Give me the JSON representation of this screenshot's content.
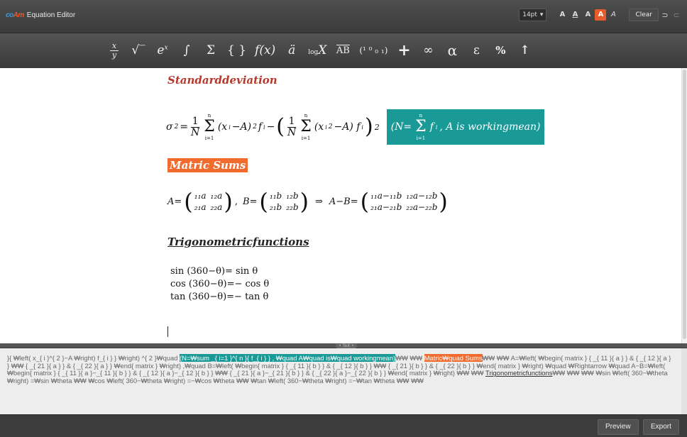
{
  "app": {
    "logo_a": "co",
    "logo_b": "Am",
    "title": "Equation Editor"
  },
  "header": {
    "font_size": "14pt",
    "font_size_arrow": "▾",
    "format_buttons": [
      "A",
      "A",
      "A",
      "A",
      "A"
    ],
    "clear_label": "Clear",
    "undo_glyph": "⊃",
    "redo_glyph": "⊂"
  },
  "toolbar": {
    "frac_num": "x",
    "frac_den": "y",
    "sqrt": "√‾",
    "exp_e": "e",
    "exp_x": "x",
    "integral": "∫",
    "sum": "Σ",
    "braces": "{ }",
    "function": "f(x)",
    "dots": "ä",
    "log": "log",
    "log_x": "X",
    "vector": "AB",
    "matrix": "(¹ ⁰ ₀ ₁)",
    "plus": "+",
    "infinity": "∞",
    "alpha": "α",
    "epsilon": "ε",
    "percent": "%",
    "arrow_up": "↑"
  },
  "document": {
    "heading1": "Standarddeviation",
    "heading2": "Matric  Sums",
    "heading3": "Trigonometricfunctions",
    "eq1": {
      "sigma": "σ",
      "sq": "2",
      "eq": "=",
      "one": "1",
      "N": "N",
      "sum_top": "n",
      "sum_bot": "i=1",
      "sum_sym": "Σ",
      "term1": "(x",
      "i": "i",
      "minus_A": "−A)",
      "pow2": "2",
      "f": "f",
      "minus": " − ",
      "term2": "(x",
      "minus_A2": "−A) f",
      "teal": "(N=",
      "teal_f": "f",
      "teal_rest": ", A  is  workingmean)"
    },
    "eq2": {
      "A": "A=",
      "B": "B=",
      "sep": ",",
      "arrow": "⇒",
      "AB": "A−B=",
      "a11": "₁₁a",
      "a12": "₁₂a",
      "a21": "₂₁a",
      "a22": "₂₂a",
      "b11": "₁₁b",
      "b12": "₁₂b",
      "b21": "₂₁b",
      "b22": "₂₂b",
      "c11": "₁₁a−₁₁b",
      "c12": "₁₂a−₁₂b",
      "c21": "₂₁a−₂₁b",
      "c22": "₂₂a−₂₂b"
    },
    "trig": [
      "sin (360−θ)= sin θ",
      "cos (360−θ)=− cos θ",
      "tan (360−θ)=− tan θ"
    ]
  },
  "splitter_label": "• TeX •",
  "source": {
    "part1": "}{ ₩left( x_{ i }^{ 2 }−A ₩right) f_{ i } }  ₩right) ^{ 2 }₩quad ",
    "teal": "(N=₩sum _{ i=1 }^{ n }{ f_{ i } } , ₩quad A₩quad is₩quad workingmean)",
    "part2": "₩₩ ₩₩ ",
    "orange": "Matric₩quad Sums",
    "part3": "₩₩ ₩₩ A=₩left( ₩begin{ matrix } { _{ 11 }{ a } } & { _{ 12 }{ a } } ₩₩ { _{ 21 }{ a } } & { _{ 22 }{ a } } ₩end{ matrix } ₩right) ,₩quad B=₩left( ₩begin{ matrix } { _{ 11 }{ b } } & { _{ 12 }{ b } } ₩₩ { _{ 21 }{ b } } & { _{ 22 }{ b } } ₩end{ matrix } ₩right) ₩quad ₩Rightarrow ₩quad A−B=₩left( ₩begin{ matrix } { _{ 11 }{ a }−_{ 11 }{ b } } & { _{ 12 }{ a }−_{ 12 }{ b } } ₩₩ { _{ 21 }{ a }−_{ 21 }{ b } } & { _{ 22 }{ a }−_{ 22 }{ b } } ₩end{ matrix } ₩right) ₩₩ ₩₩ ",
    "bold": "Trigonometricfunctions",
    "part4": "₩₩ ₩₩ ₩₩ ₩sin ₩left( 360−₩theta ₩right) =₩sin  ₩theta ₩₩ ₩cos ₩left( 360−₩theta ₩right) =−₩cos  ₩theta ₩₩ ₩tan ₩left( 360−₩theta ₩right) =−₩tan  ₩theta ₩₩ ₩₩"
  },
  "footer": {
    "preview_label": "Preview",
    "export_label": "Export"
  }
}
